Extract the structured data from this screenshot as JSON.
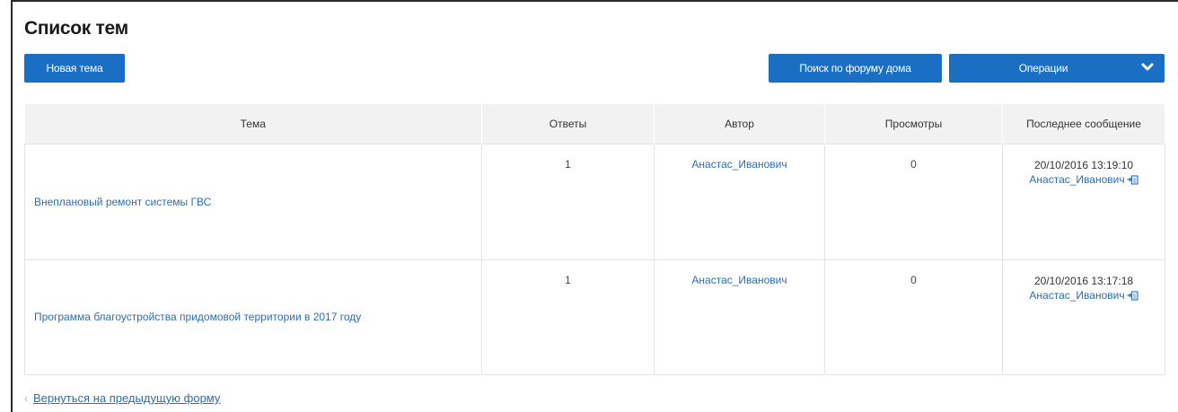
{
  "page": {
    "title": "Список тем"
  },
  "toolbar": {
    "new_topic_label": "Новая тема",
    "search_label": "Поиск по форуму дома",
    "operations_label": "Операции"
  },
  "table": {
    "headers": [
      "Тема",
      "Ответы",
      "Автор",
      "Просмотры",
      "Последнее сообщение"
    ],
    "rows": [
      {
        "topic": "Внеплановый ремонт системы ГВС",
        "replies": "1",
        "author": "Анастас_Иванович",
        "views": "0",
        "last_date": "20/10/2016 13:19:10",
        "last_author": "Анастас_Иванович"
      },
      {
        "topic": "Программа благоустройства придомовой территории в 2017 году",
        "replies": "1",
        "author": "Анастас_Иванович",
        "views": "0",
        "last_date": "20/10/2016 13:17:18",
        "last_author": "Анастас_Иванович"
      }
    ]
  },
  "footer": {
    "back_label": "Вернуться на предыдущую форму"
  },
  "icons": {
    "operations_dropdown": "chevron-down-icon",
    "goto_message": "goto-message-icon",
    "back": "back-arrow-icon"
  },
  "colors": {
    "accent": "#1a6fc2",
    "link": "#2a6db5",
    "header_bg": "#f2f2f2"
  }
}
